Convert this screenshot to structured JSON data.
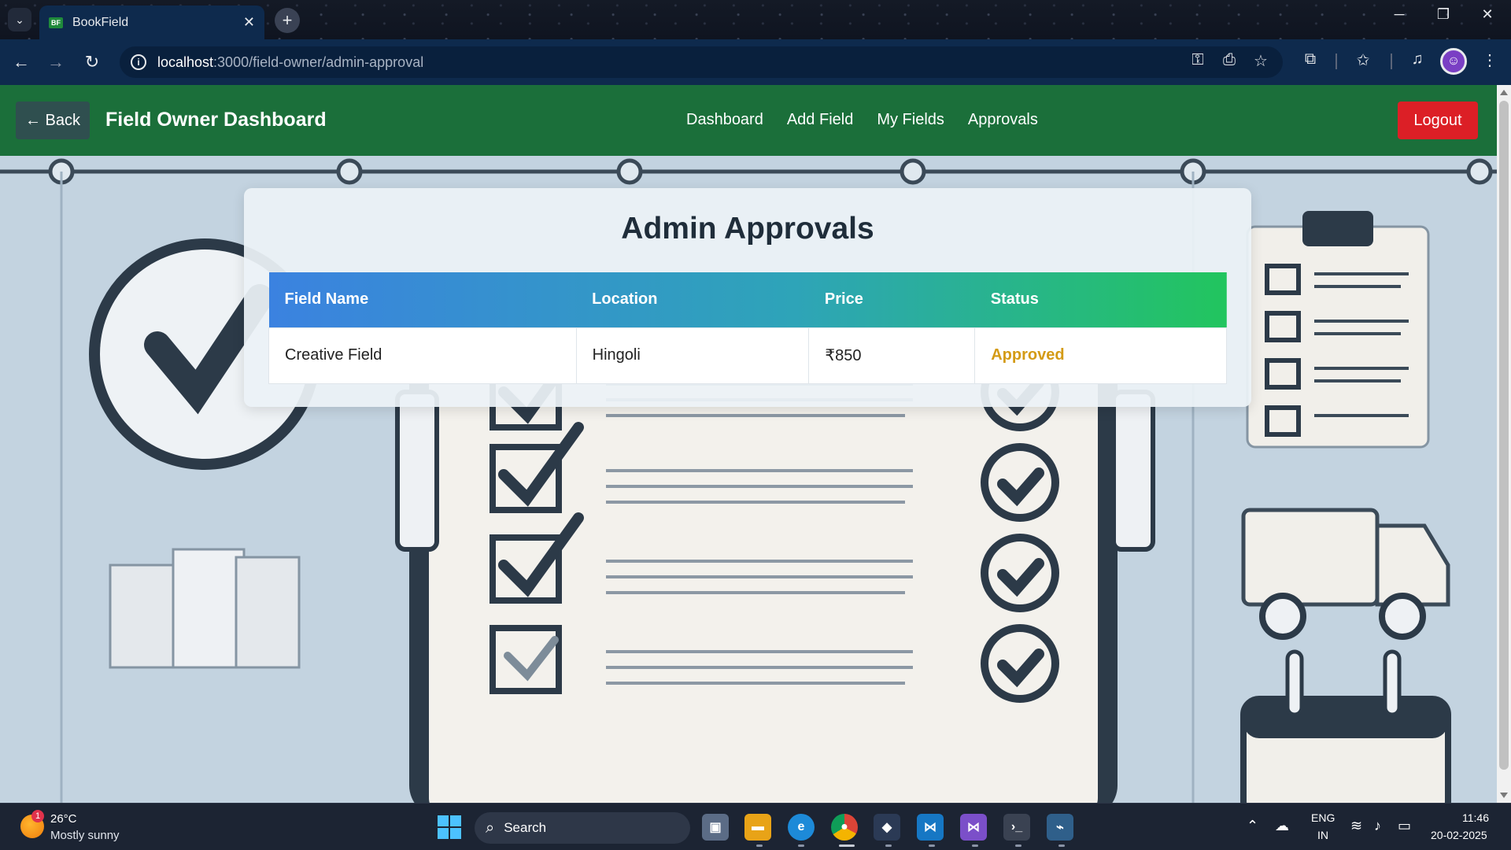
{
  "browser": {
    "tab_title": "BookField",
    "new_tab_symbol": "+",
    "url_host": "localhost",
    "url_path": ":3000/field-owner/admin-approval"
  },
  "navbar": {
    "back_label": "← Back",
    "brand": "Field Owner Dashboard",
    "links": [
      "Dashboard",
      "Add Field",
      "My Fields",
      "Approvals"
    ],
    "logout_label": "Logout",
    "color": "#1b6f3a"
  },
  "main": {
    "title": "Admin Approvals",
    "table": {
      "headers": [
        "Field Name",
        "Location",
        "Price",
        "Status"
      ],
      "rows": [
        [
          "Creative Field",
          "Hingoli",
          "₹850",
          "Approved"
        ]
      ]
    },
    "status_color": "#d49b16"
  },
  "taskbar": {
    "weather_badge": "1",
    "weather_temp": "26°C",
    "weather_desc": "Mostly sunny",
    "search_label": "Search",
    "lang_line1": "ENG",
    "lang_line2": "IN",
    "time": "11:46",
    "date": "20-02-2025"
  },
  "icons": [
    "chevron-down-icon",
    "close-icon",
    "back-arrow-icon",
    "forward-arrow-icon",
    "reload-icon",
    "info-icon",
    "password-key-icon",
    "install-app-icon",
    "star-icon",
    "extensions-icon",
    "bookmarks-icon",
    "media-icon",
    "profile-avatar-icon",
    "menu-icon",
    "windows-start-icon",
    "search-icon",
    "wifi-icon",
    "volume-icon",
    "battery-icon"
  ]
}
